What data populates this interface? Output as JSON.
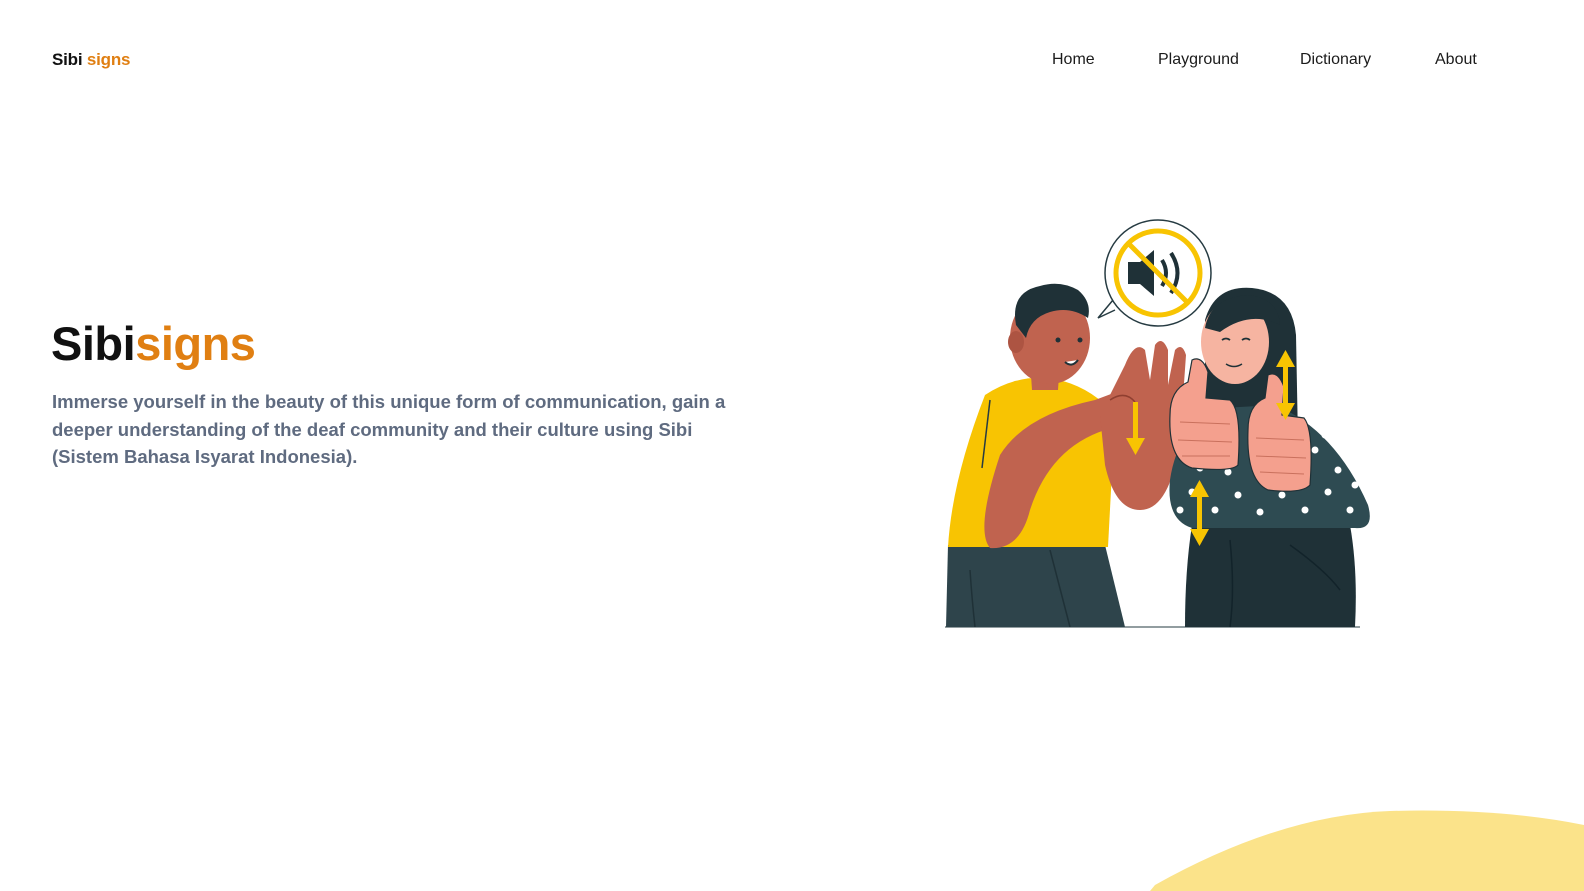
{
  "header": {
    "logo": {
      "part1": "Sibi",
      "part2": "signs"
    },
    "nav": [
      {
        "label": "Home"
      },
      {
        "label": "Playground"
      },
      {
        "label": "Dictionary"
      },
      {
        "label": "About"
      }
    ]
  },
  "hero": {
    "title_part1": "Sibi",
    "title_part2": "signs",
    "description": "Immerse yourself in the beauty of this unique form of communication, gain a deeper understanding of the deaf community and their culture using Sibi (Sistem Bahasa Isyarat Indonesia)."
  },
  "colors": {
    "accent": "#e07f12",
    "text_dark": "#111111",
    "text_muted": "#5f6b80",
    "illustration_yellow": "#f8c402",
    "illustration_dark": "#263b42",
    "wave": "#fbe38a"
  },
  "illustration": {
    "icon": "muted-speaker-icon",
    "subject": "two-people-signing-illustration"
  }
}
